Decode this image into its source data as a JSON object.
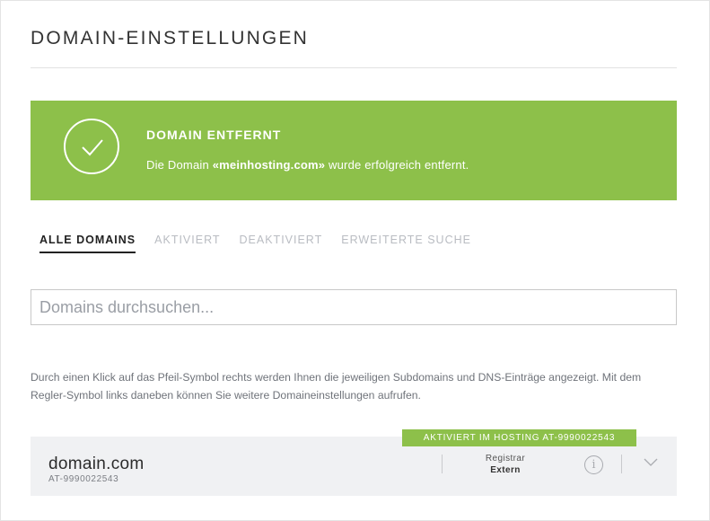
{
  "page": {
    "title": "DOMAIN-EINSTELLUNGEN"
  },
  "banner": {
    "title": "DOMAIN ENTFERNT",
    "message_prefix": "Die Domain ",
    "message_domain": "«meinhosting.com»",
    "message_suffix": " wurde erfolgreich entfernt.",
    "icon": "check-circle-icon",
    "color": "#8dc04a"
  },
  "tabs": [
    {
      "label": "ALLE DOMAINS",
      "active": true
    },
    {
      "label": "AKTIVIERT",
      "active": false
    },
    {
      "label": "DEAKTIVIERT",
      "active": false
    },
    {
      "label": "ERWEITERTE SUCHE",
      "active": false
    }
  ],
  "search": {
    "placeholder": "Domains durchsuchen...",
    "value": ""
  },
  "help_text": "Durch einen Klick auf das Pfeil-Symbol rechts werden Ihnen die jeweiligen Subdomains und DNS-Einträge angezeigt. Mit dem Regler-Symbol links daneben können Sie weitere Domaineinstellungen aufrufen.",
  "domains": [
    {
      "name": "domain.com",
      "id": "AT-9990022543",
      "status_badge": "AKTIVIERT IM HOSTING AT-9990022543",
      "registrar_label": "Registrar",
      "registrar_value": "Extern",
      "info_icon": "i"
    }
  ]
}
